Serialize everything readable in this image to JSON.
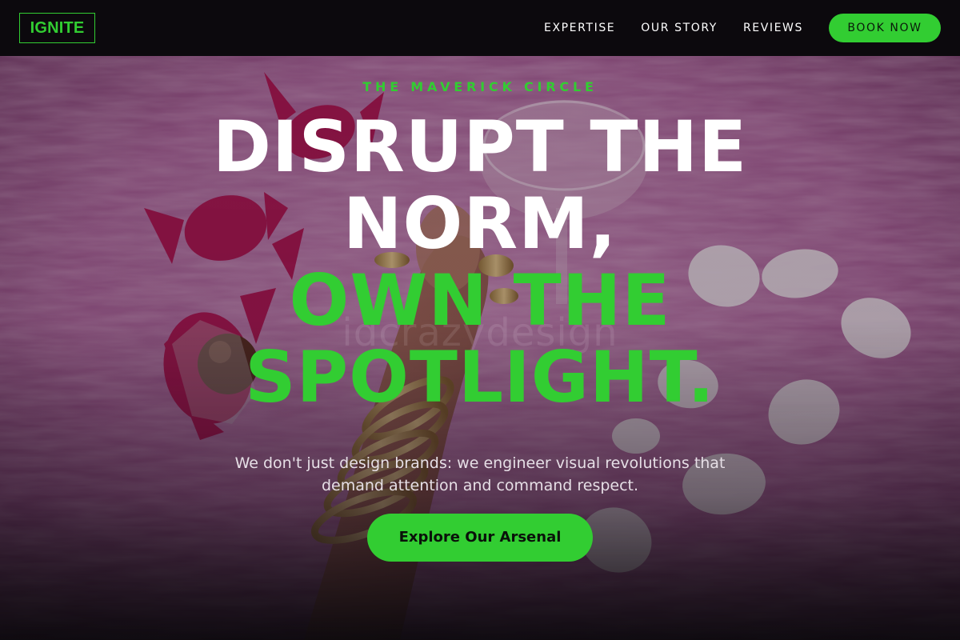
{
  "header": {
    "logo": "IGNITE",
    "nav": [
      {
        "label": "EXPERTISE"
      },
      {
        "label": "OUR STORY"
      },
      {
        "label": "REVIEWS"
      }
    ],
    "cta_label": "BOOK NOW"
  },
  "hero": {
    "eyebrow": "THE MAVERICK CIRCLE",
    "headline": {
      "line1": "DISRUPT THE",
      "line2": "NORM,",
      "line3": "OWN THE",
      "line4": "SPOTLIGHT."
    },
    "subtitle": "We don't just design brands: we engineer visual revolutions that demand attention and command respect.",
    "cta_label": "Explore Our Arsenal",
    "watermark": "idcrazydesign"
  },
  "colors": {
    "accent": "#32CD32",
    "background": "#0A080C",
    "headline_white": "#FFFFFF",
    "fur_pink": "#B86FA4"
  }
}
